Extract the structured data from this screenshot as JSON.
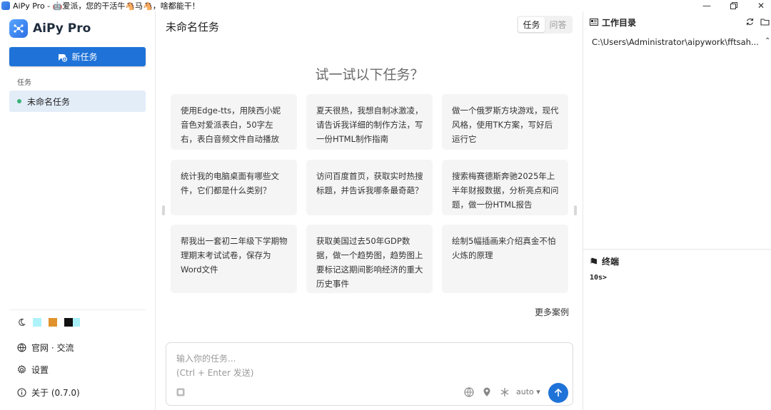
{
  "window": {
    "title": "AiPy Pro - 🤖爱派，您的干活牛🐴马🐴，啥都能干！",
    "controls": [
      "minimize-icon",
      "restore-icon",
      "close-icon"
    ]
  },
  "sidebar": {
    "brand": "AiPy Pro",
    "new_task": "新任务",
    "section_label": "任务",
    "tasks": [
      {
        "label": "未命名任务",
        "status_color": "#3bb27a"
      }
    ],
    "theme_swatches": [
      "#aef2fa",
      "#e0922c",
      "#111111",
      "#a8f0f8"
    ],
    "links": {
      "official": "官网 · 交流",
      "settings": "设置",
      "about": "关于 (0.7.0)"
    }
  },
  "main": {
    "title": "未命名任务",
    "modes": [
      "任务",
      "问答"
    ],
    "active_mode": "任务",
    "hero": "试一试以下任务？",
    "cards": [
      "使用Edge-tts，用陕西小妮音色对爱派表白，50字左右，表白音频文件自动播放",
      "夏天很热，我想自制冰激凌，请告诉我详细的制作方法，写一份HTML制作指南",
      "做一个俄罗斯方块游戏，现代风格，使用TK方案，写好后运行它",
      "统计我的电脑桌面有哪些文件，它们都是什么类别？",
      "访问百度首页，获取实时热搜标题，并告诉我哪条最奇葩？",
      "搜索梅赛德斯奔驰2025年上半年财报数据，分析亮点和问题，做一份HTML报告",
      "帮我出一套初二年级下学期物理期末考试试卷，保存为Word文件",
      "获取美国过去50年GDP数据，做一个趋势图，趋势图上要标记这期间影响经济的重大历史事件",
      "绘制5幅插画来介绍真金不怕火炼的原理"
    ],
    "more": "更多案例",
    "input": {
      "placeholder_line1": "输入你的任务...",
      "placeholder_line2": "(Ctrl + Enter 发送)",
      "model": "auto ▾"
    }
  },
  "right": {
    "workdir_label": "工作目录",
    "workdir_path": "C:\\Users\\Administrator\\aipywork\\fftsah...",
    "terminal_label": "终端",
    "terminal_line": "10s>"
  },
  "colors": {
    "accent": "#1f73d8",
    "selected_bg": "#e3edf8",
    "card_bg": "#f5f5f5"
  }
}
